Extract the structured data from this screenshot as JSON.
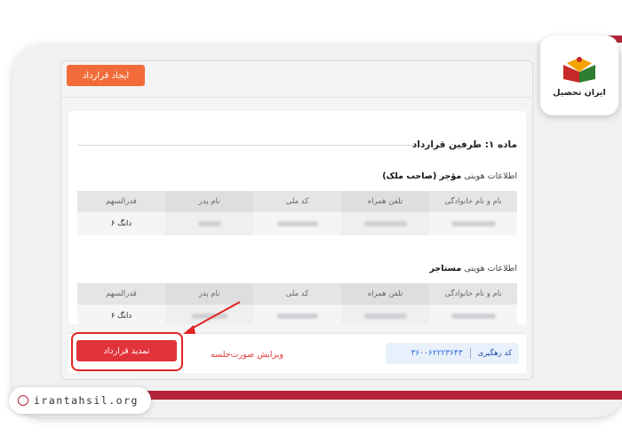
{
  "toolbar": {
    "create_label": "ایجاد قرارداد"
  },
  "section": {
    "title": "ماده ۱: طرفین قرارداد"
  },
  "owner": {
    "prefix": "اطلاعات هویتی ",
    "role": "مؤجر (صاحب ملک)"
  },
  "tenant": {
    "prefix": "اطلاعات هویتی ",
    "role": "مستاجر"
  },
  "table": {
    "headers": [
      "نام و نام خانوادگی",
      "تلفن همراه",
      "کد ملی",
      "نام پدر",
      "قدرالسهم"
    ],
    "owner_row": {
      "share": "۶ دانگ"
    },
    "tenant_row": {
      "share": "۶ دانگ"
    }
  },
  "footer": {
    "tracking_label": "کد رهگیری",
    "tracking_number": "۳۶۰۰۶۲۲۲۳۶۴۳",
    "edit_label": "ویرایش صورت‌جلسه",
    "renew_label": "تمدید قرارداد"
  },
  "brand": {
    "logo_text": "ایران تحصیل",
    "site": "irantahsil.org"
  },
  "colors": {
    "accent_orange": "#f26c3a",
    "accent_red": "#e2323a",
    "brand_red": "#b3243a"
  }
}
